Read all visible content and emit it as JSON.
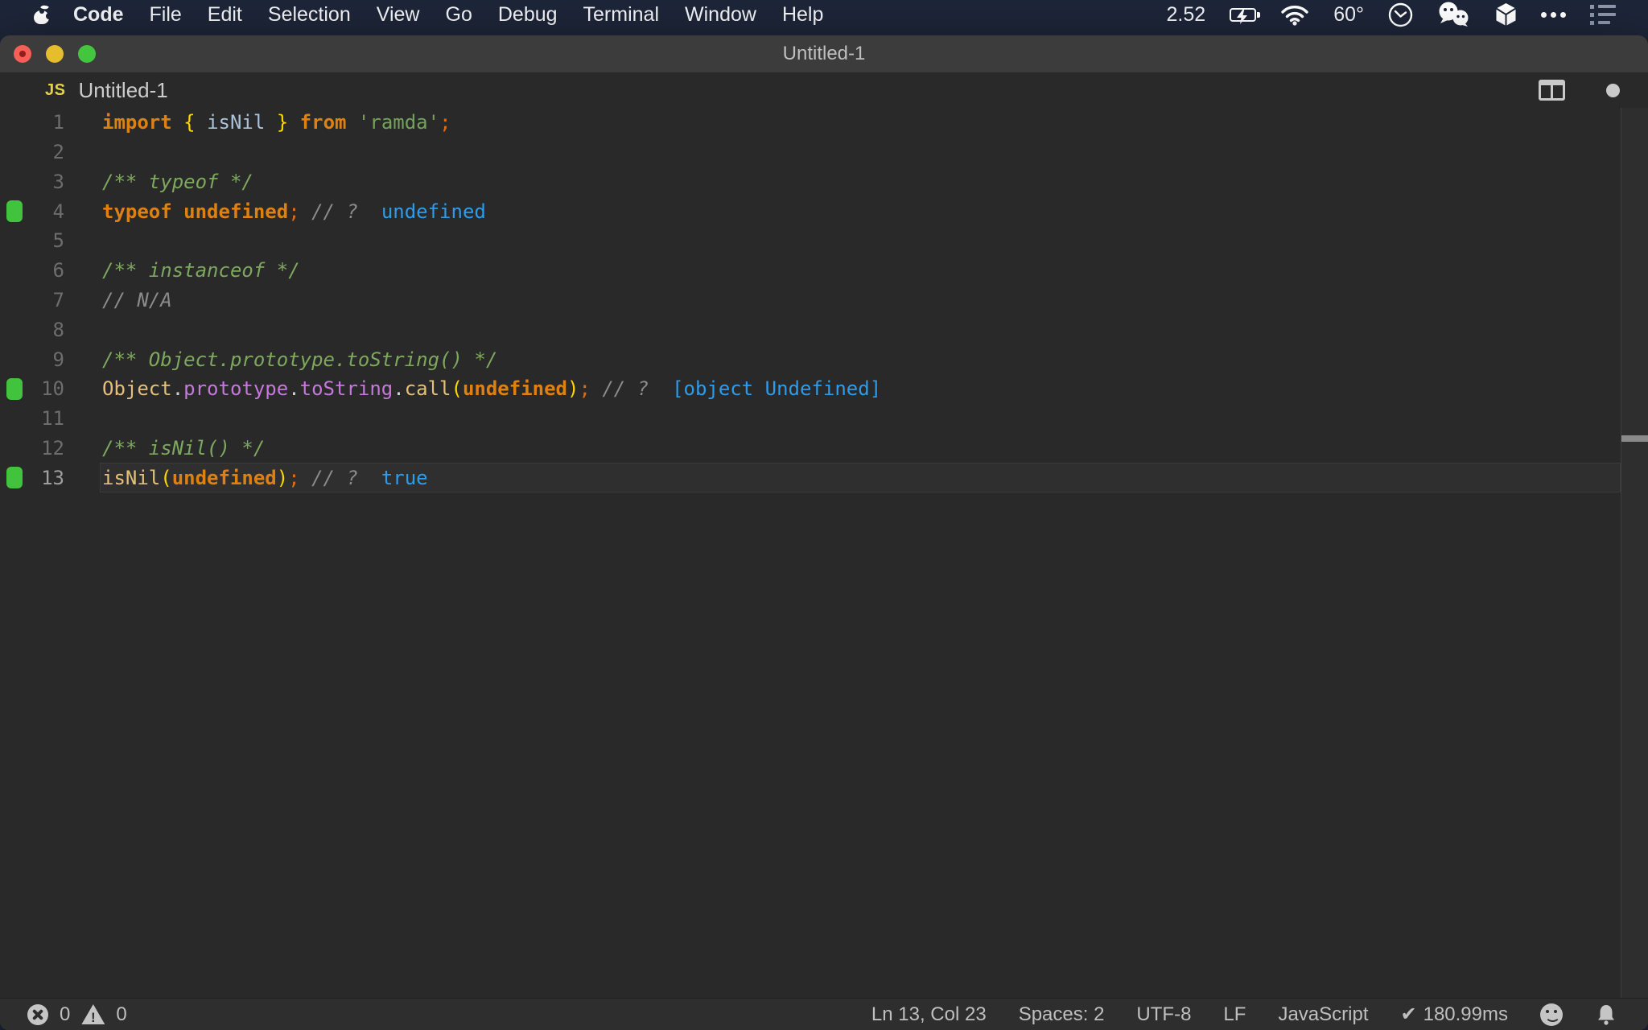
{
  "menu_bar": {
    "app_menu": "Code",
    "items": [
      "File",
      "Edit",
      "Selection",
      "View",
      "Go",
      "Debug",
      "Terminal",
      "Window",
      "Help"
    ],
    "status_value": "2.52",
    "temperature": "60°",
    "icons": [
      "apple-icon",
      "battery-charging-icon",
      "wifi-icon",
      "clock-icon",
      "wechat-icon",
      "cube-icon",
      "more-dots-icon",
      "list-icon"
    ]
  },
  "window": {
    "title": "Untitled-1"
  },
  "editor_header": {
    "language_badge": "JS",
    "file_name": "Untitled-1",
    "icons": [
      "split-editor-icon",
      "unsaved-dot-icon"
    ]
  },
  "editor": {
    "lines": [
      {
        "num": 1,
        "tokens": [
          [
            "kw",
            "import"
          ],
          [
            "pl",
            " "
          ],
          [
            "br",
            "{"
          ],
          [
            "pl",
            " "
          ],
          [
            "vr",
            "isNil"
          ],
          [
            "pl",
            " "
          ],
          [
            "br",
            "}"
          ],
          [
            "pl",
            " "
          ],
          [
            "kw",
            "from"
          ],
          [
            "pl",
            " "
          ],
          [
            "st",
            "'ramda'"
          ],
          [
            "sm",
            ";"
          ]
        ]
      },
      {
        "num": 2,
        "tokens": []
      },
      {
        "num": 3,
        "tokens": [
          [
            "cg",
            "/** typeof */"
          ]
        ]
      },
      {
        "num": 4,
        "marker": true,
        "tokens": [
          [
            "kw",
            "typeof"
          ],
          [
            "pl",
            " "
          ],
          [
            "kw",
            "undefined"
          ],
          [
            "sm",
            ";"
          ],
          [
            "pl",
            " "
          ],
          [
            "cl",
            "// ?"
          ],
          [
            "pl",
            "  "
          ],
          [
            "rs",
            "undefined"
          ]
        ]
      },
      {
        "num": 5,
        "tokens": []
      },
      {
        "num": 6,
        "tokens": [
          [
            "cg",
            "/** instanceof */"
          ]
        ]
      },
      {
        "num": 7,
        "tokens": [
          [
            "cl",
            "// N/A"
          ]
        ]
      },
      {
        "num": 8,
        "tokens": []
      },
      {
        "num": 9,
        "tokens": [
          [
            "cg",
            "/** Object.prototype.toString() */"
          ]
        ]
      },
      {
        "num": 10,
        "marker": true,
        "tokens": [
          [
            "fn",
            "Object"
          ],
          [
            "dt",
            "."
          ],
          [
            "pr",
            "prototype"
          ],
          [
            "dt",
            "."
          ],
          [
            "pr",
            "toString"
          ],
          [
            "dt",
            "."
          ],
          [
            "fn",
            "call"
          ],
          [
            "br",
            "("
          ],
          [
            "kw",
            "undefined"
          ],
          [
            "br",
            ")"
          ],
          [
            "sm",
            ";"
          ],
          [
            "pl",
            " "
          ],
          [
            "cl",
            "// ?"
          ],
          [
            "pl",
            "  "
          ],
          [
            "rs",
            "[object Undefined]"
          ]
        ]
      },
      {
        "num": 11,
        "tokens": []
      },
      {
        "num": 12,
        "tokens": [
          [
            "cg",
            "/** isNil() */"
          ]
        ]
      },
      {
        "num": 13,
        "marker": true,
        "active": true,
        "tokens": [
          [
            "fn",
            "isNil"
          ],
          [
            "br",
            "("
          ],
          [
            "kw",
            "undefined"
          ],
          [
            "br",
            ")"
          ],
          [
            "sm",
            ";"
          ],
          [
            "pl",
            " "
          ],
          [
            "cl",
            "// ?"
          ],
          [
            "pl",
            "  "
          ],
          [
            "rs",
            "true"
          ]
        ]
      }
    ]
  },
  "status_bar": {
    "errors": "0",
    "warnings": "0",
    "items": [
      "Ln 13, Col 23",
      "Spaces: 2",
      "UTF-8",
      "LF",
      "JavaScript"
    ],
    "perf_check": "✔",
    "perf": "180.99ms"
  },
  "colors": {
    "menubar-bg": "#1d2538",
    "chrome": "#3c3c3c",
    "editor-bg": "#292929",
    "status-bg": "#2e2e2e",
    "kw": "#de8112",
    "brace": "#ffd502",
    "variable": "#abc2d8",
    "string": "#74a25c",
    "semi": "#e06b10",
    "comment-doc": "#7da85e",
    "comment-line": "#8b8b8b",
    "func": "#e5c07b",
    "prop": "#c678dd",
    "dot": "#d0d0d0",
    "result": "#2d9ceb",
    "marker": "#41c33d",
    "linenum": "#6d6d6d",
    "linenum-active": "#9e9e9e",
    "traffic-red": "#f65f56",
    "traffic-yellow": "#e6bd2d",
    "traffic-green": "#43c53e"
  }
}
